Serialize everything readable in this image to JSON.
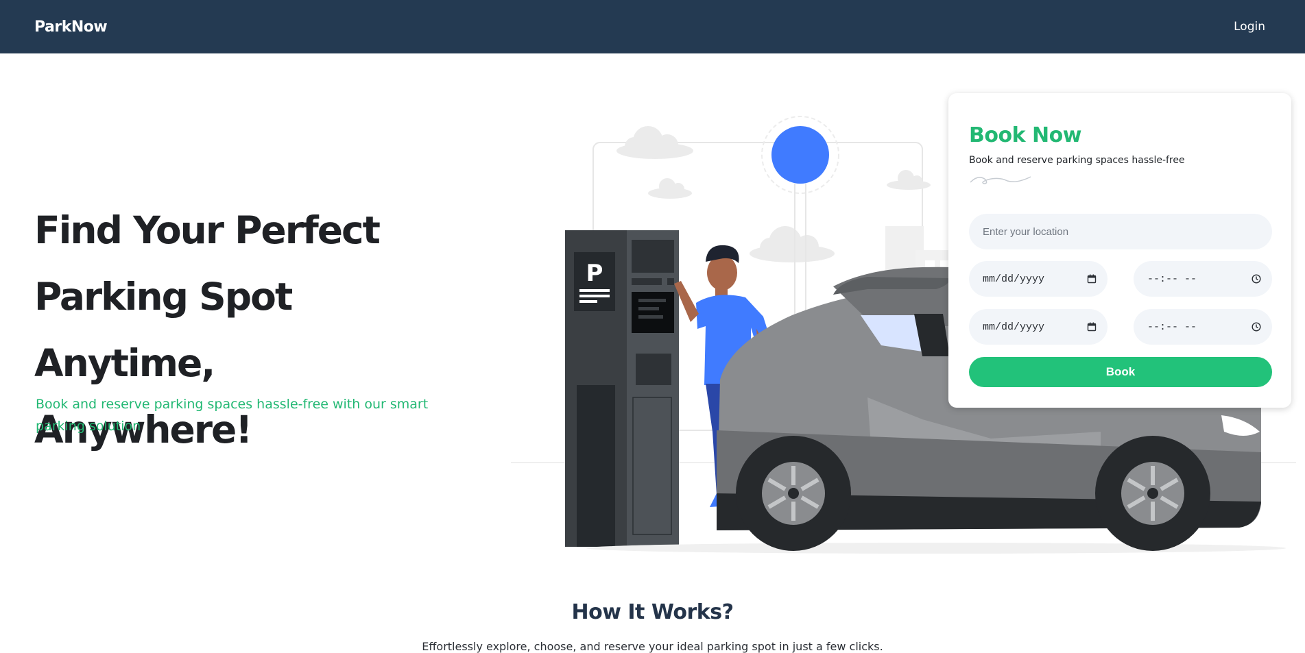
{
  "nav": {
    "brand": "ParkNow",
    "login_label": "Login"
  },
  "hero": {
    "title_line1": "Find Your Perfect",
    "title_line2": "Parking Spot Anytime,",
    "title_line3": "Anywhere!",
    "subtitle": "Book and reserve parking spaces hassle-free with our smart parking solution",
    "illustration_parking_sign": "P"
  },
  "booking": {
    "title": "Book Now",
    "subtitle": "Book and reserve parking spaces hassle-free",
    "location_placeholder": "Enter your location",
    "start_date_placeholder": "mm/dd/yyyy",
    "start_time_placeholder": "--:-- --",
    "end_date_placeholder": "mm/dd/yyyy",
    "end_time_placeholder": "--:-- --",
    "book_label": "Book"
  },
  "how": {
    "title": "How It Works?",
    "subtitle": "Effortlessly explore, choose, and reserve your ideal parking spot in just a few clicks."
  },
  "colors": {
    "navbar": "#243a52",
    "accent_green": "#22b873",
    "button_green": "#22c27a",
    "illustration_blue": "#407bff"
  },
  "icons": {
    "calendar": "calendar-icon",
    "clock": "clock-icon"
  }
}
